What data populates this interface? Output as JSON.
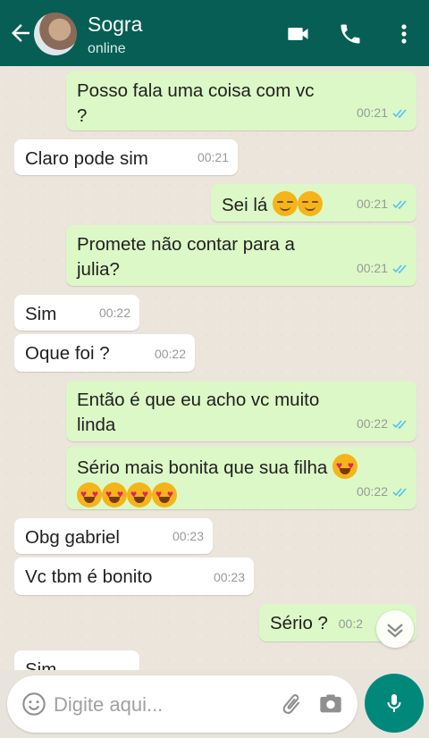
{
  "header": {
    "contact_name": "Sogra",
    "status": "online",
    "icons": [
      "back-arrow-icon",
      "avatar",
      "video-call-icon",
      "phone-icon",
      "more-options-icon"
    ],
    "color": "#075e54"
  },
  "messages": [
    {
      "dir": "out",
      "text": "Posso fala uma coisa com vc ?",
      "time": "00:21",
      "read": true
    },
    {
      "dir": "in",
      "text": "Claro pode sim",
      "time": "00:21"
    },
    {
      "dir": "out",
      "text": "Sei lá",
      "time": "00:21",
      "read": true
    },
    {
      "dir": "out",
      "text": "Promete não contar para a julia?",
      "time": "00:21",
      "read": true
    },
    {
      "dir": "in",
      "text": "Sim",
      "time": "00:22"
    },
    {
      "dir": "in",
      "text": "Oque foi ?",
      "time": "00:22"
    },
    {
      "dir": "out",
      "text": "Então é que eu acho vc muito linda",
      "time": "00:22",
      "read": true
    },
    {
      "dir": "out",
      "text": "Sério mais bonita que sua filha",
      "time": "00:22",
      "read": true
    },
    {
      "dir": "in",
      "text": "Obg gabriel",
      "time": "00:23"
    },
    {
      "dir": "in",
      "text": "Vc tbm é bonito",
      "time": "00:23"
    },
    {
      "dir": "out",
      "text": "Sério ?",
      "time": "00:2",
      "read": false
    },
    {
      "dir": "in",
      "text": "Sim",
      "time": ""
    }
  ],
  "composer": {
    "placeholder": "Digite aqui...",
    "icons": [
      "emoji-icon",
      "attach-icon",
      "camera-icon",
      "mic-icon"
    ]
  },
  "colors": {
    "outgoing": "#dcf8c6",
    "incoming": "#ffffff",
    "read_ticks": "#4fc3f7",
    "accent": "#00897b"
  }
}
